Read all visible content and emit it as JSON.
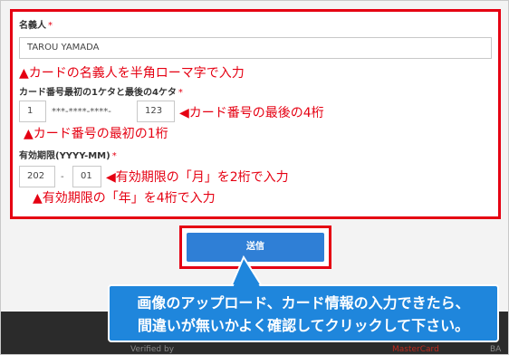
{
  "form": {
    "name_label": "名義人",
    "required_mark": "*",
    "name_value": "TAROU YAMADA",
    "name_note": "▲カードの名義人を半角ローマ字で入力",
    "card_label": "カード番号最初の1ケタと最後の4ケタ",
    "card_first": "1",
    "card_mask": "***-****-****-",
    "card_last": "123",
    "card_last_note": "◀カード番号の最後の4桁",
    "card_first_note": "▲カード番号の最初の1桁",
    "expiry_label": "有効期限(YYYY-MM)",
    "expiry_year": "202",
    "expiry_dash": "-",
    "expiry_month": "01",
    "expiry_month_note": "◀有効期限の「月」を2桁で入力",
    "expiry_year_note": "▲有効期限の「年」を4桁で入力"
  },
  "submit_label": "送信",
  "callout": {
    "line1": "画像のアップロード、カード情報の入力できたら、",
    "line2": "間違いが無いかよく確認してクリックして下さい。"
  },
  "footer": {
    "logos": [
      "Verified by",
      "MasterCard",
      "BA"
    ]
  },
  "colors": {
    "accent_red": "#e50012",
    "button_blue": "#2f7fd6",
    "callout_blue": "#1f86dc",
    "footer_dark": "#2b2b2b"
  }
}
